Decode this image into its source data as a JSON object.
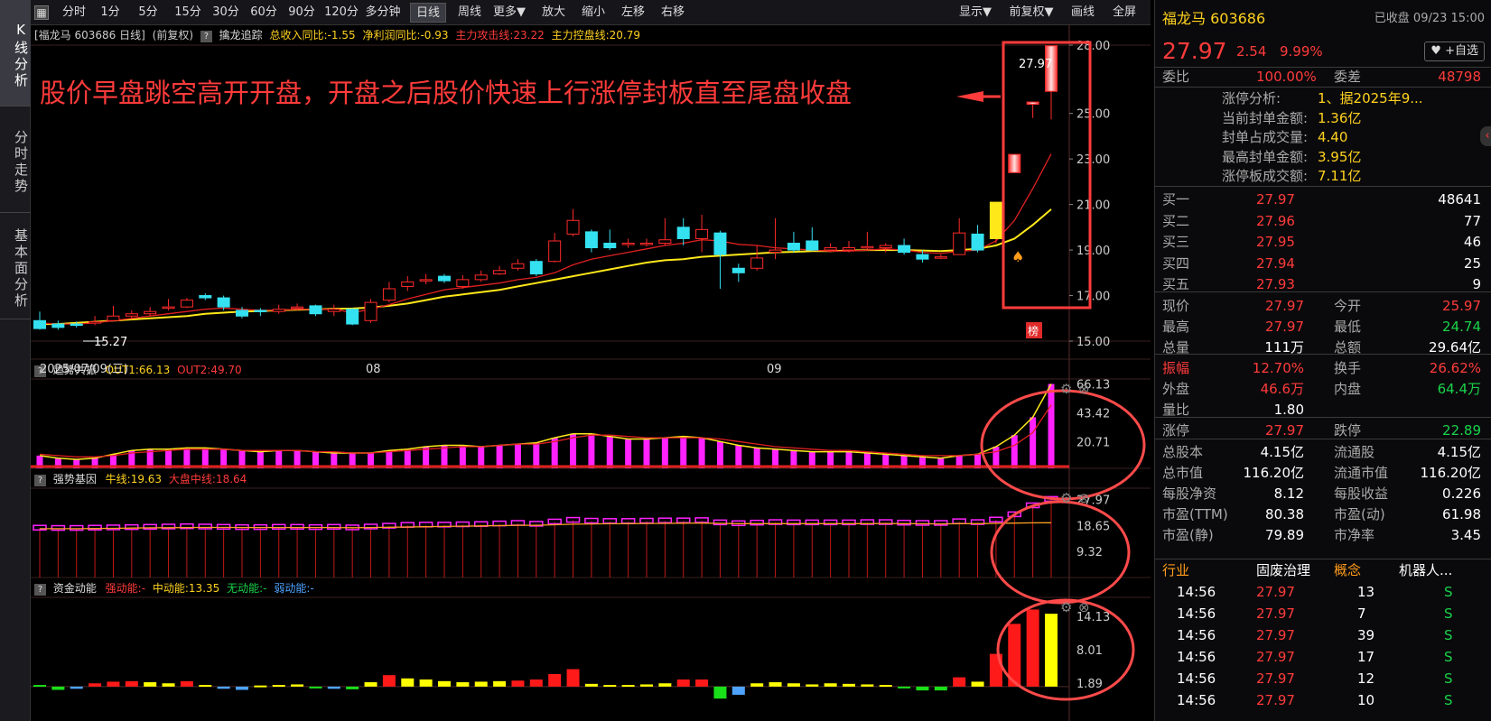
{
  "nav": {
    "tabs": [
      "K线分析",
      "分时走势",
      "基本面分析"
    ]
  },
  "toolbar": {
    "buttons": [
      "分时",
      "1分",
      "5分",
      "15分",
      "30分",
      "60分",
      "90分",
      "120分",
      "多分钟",
      "日线",
      "周线",
      "更多▼",
      "放大",
      "缩小",
      "左移",
      "右移"
    ],
    "right_buttons": [
      "显示▼",
      "前复权▼",
      "画线",
      "全屏"
    ],
    "active": "日线"
  },
  "info": {
    "stock": "[福龙马 603686 日线]",
    "adj": "(前复权)",
    "indicator": "擒龙追踪",
    "rev_yoy": "总收入同比:-1.55",
    "np_yoy": "净利润同比:-0.93",
    "attack": "主力攻击线:23.22",
    "control": "主力控盘线:20.79"
  },
  "annotation": {
    "text": "股价早盘跳空高开开盘，开盘之后股价快速上行涨停封板直至尾盘收盘",
    "price_label": "27.97",
    "low_label": "15.27",
    "bang": "榜"
  },
  "axis": {
    "date_label": "2025/07/09(三)",
    "month_labels": [
      "08",
      "09"
    ]
  },
  "chart_data": [
    {
      "type": "candlestick",
      "title": "福龙马 603686 日线",
      "ylim": [
        15.0,
        28.0
      ],
      "y_ticks": [
        "28.00",
        "25.00",
        "23.00",
        "21.00",
        "19.00",
        "17.00",
        "15.00"
      ],
      "candles": [
        [
          15.9,
          15.55,
          16.3,
          15.5
        ],
        [
          15.75,
          15.6,
          15.9,
          15.5
        ],
        [
          15.75,
          15.7,
          15.85,
          15.6
        ],
        [
          15.85,
          15.85,
          16.1,
          15.7
        ],
        [
          15.9,
          16.1,
          16.55,
          15.85
        ],
        [
          16.1,
          16.2,
          16.35,
          16.0
        ],
        [
          16.2,
          16.3,
          16.5,
          16.1
        ],
        [
          16.5,
          16.5,
          16.85,
          16.35
        ],
        [
          16.5,
          16.8,
          16.9,
          16.45
        ],
        [
          17.0,
          16.9,
          17.1,
          16.8
        ],
        [
          16.9,
          16.5,
          17.0,
          16.35
        ],
        [
          16.35,
          16.1,
          16.5,
          16.0
        ],
        [
          16.35,
          16.3,
          16.45,
          16.1
        ],
        [
          16.3,
          16.4,
          16.6,
          16.2
        ],
        [
          16.45,
          16.5,
          16.65,
          16.35
        ],
        [
          16.55,
          16.2,
          16.6,
          16.1
        ],
        [
          16.3,
          16.4,
          16.6,
          16.1
        ],
        [
          16.4,
          15.75,
          16.45,
          15.7
        ],
        [
          15.9,
          16.7,
          16.85,
          15.8
        ],
        [
          16.8,
          17.3,
          17.6,
          16.7
        ],
        [
          17.4,
          17.6,
          17.85,
          17.2
        ],
        [
          17.7,
          17.7,
          17.95,
          17.5
        ],
        [
          17.85,
          17.65,
          17.95,
          17.55
        ],
        [
          17.4,
          17.7,
          17.9,
          17.3
        ],
        [
          17.7,
          17.9,
          18.1,
          17.6
        ],
        [
          17.95,
          18.1,
          18.3,
          17.9
        ],
        [
          18.2,
          18.4,
          18.6,
          18.1
        ],
        [
          18.5,
          17.95,
          18.6,
          17.85
        ],
        [
          18.5,
          19.4,
          19.75,
          18.45
        ],
        [
          19.7,
          20.3,
          20.8,
          19.6
        ],
        [
          19.8,
          19.1,
          19.9,
          18.9
        ],
        [
          19.3,
          19.1,
          19.9,
          19.0
        ],
        [
          19.3,
          19.3,
          19.5,
          19.1
        ],
        [
          19.3,
          19.3,
          19.5,
          19.15
        ],
        [
          19.3,
          19.45,
          20.4,
          19.2
        ],
        [
          20.0,
          19.5,
          20.4,
          19.2
        ],
        [
          19.5,
          19.9,
          20.55,
          18.9
        ],
        [
          19.75,
          18.8,
          19.85,
          17.3
        ],
        [
          18.2,
          18.0,
          18.4,
          17.6
        ],
        [
          18.2,
          18.65,
          19.2,
          18.1
        ],
        [
          18.9,
          19.0,
          20.4,
          18.6
        ],
        [
          19.3,
          19.0,
          19.8,
          18.9
        ],
        [
          19.4,
          19.0,
          20.0,
          18.95
        ],
        [
          19.0,
          19.1,
          19.3,
          18.9
        ],
        [
          19.0,
          19.1,
          19.4,
          18.9
        ],
        [
          19.1,
          19.15,
          19.8,
          19.0
        ],
        [
          19.1,
          19.2,
          19.3,
          18.9
        ],
        [
          19.2,
          18.9,
          19.5,
          18.8
        ],
        [
          18.8,
          18.6,
          19.0,
          18.45
        ],
        [
          18.7,
          18.7,
          18.8,
          18.6
        ],
        [
          18.8,
          19.75,
          20.4,
          18.8
        ],
        [
          19.7,
          19.0,
          20.1,
          18.9
        ],
        [
          19.5,
          21.1,
          21.1,
          19.3
        ],
        [
          22.4,
          23.2,
          23.2,
          22.4
        ],
        [
          25.4,
          25.5,
          25.4,
          24.8
        ],
        [
          25.97,
          27.97,
          27.97,
          24.74
        ]
      ],
      "ma_attack": [
        15.8,
        15.75,
        15.75,
        15.8,
        15.9,
        16.0,
        16.1,
        16.2,
        16.3,
        16.4,
        16.45,
        16.4,
        16.35,
        16.35,
        16.4,
        16.4,
        16.4,
        16.25,
        16.4,
        16.6,
        16.85,
        17.05,
        17.25,
        17.35,
        17.45,
        17.55,
        17.7,
        17.8,
        18.0,
        18.35,
        18.6,
        18.75,
        18.9,
        19.05,
        19.2,
        19.3,
        19.45,
        19.4,
        19.25,
        19.2,
        19.1,
        19.05,
        19.0,
        18.95,
        18.95,
        19.0,
        19.05,
        19.0,
        18.9,
        18.85,
        18.95,
        19.0,
        19.4,
        20.3,
        21.7,
        23.22
      ],
      "ma_control": [
        15.75,
        15.75,
        15.8,
        15.85,
        15.9,
        15.95,
        16.0,
        16.05,
        16.1,
        16.2,
        16.25,
        16.3,
        16.32,
        16.35,
        16.38,
        16.4,
        16.42,
        16.43,
        16.48,
        16.55,
        16.65,
        16.8,
        16.95,
        17.05,
        17.15,
        17.25,
        17.4,
        17.55,
        17.7,
        17.85,
        18.0,
        18.15,
        18.3,
        18.45,
        18.55,
        18.6,
        18.7,
        18.75,
        18.8,
        18.85,
        18.9,
        18.92,
        18.95,
        18.95,
        18.98,
        19.0,
        19.0,
        19.0,
        18.98,
        18.95,
        19.0,
        19.05,
        19.2,
        19.5,
        20.1,
        20.79
      ]
    },
    {
      "type": "bar",
      "title": "趋势共振",
      "legend": [
        "OUT1:66.13",
        "OUT2:49.70"
      ],
      "y_ticks": [
        "66.13",
        "43.42",
        "20.71"
      ],
      "ylim": [
        0,
        70
      ],
      "out1": [
        10,
        8,
        7,
        8,
        11,
        14,
        15,
        15,
        16,
        16,
        15,
        14,
        13,
        14,
        14,
        13,
        12,
        12,
        12,
        14,
        15,
        17,
        18,
        18,
        17,
        18,
        19,
        20,
        24,
        27,
        27,
        25,
        23,
        23,
        24,
        25,
        24,
        21,
        18,
        16,
        15,
        14,
        13,
        13,
        13,
        12,
        11,
        10,
        9,
        8,
        10,
        11,
        17,
        26,
        40,
        66.13
      ],
      "out2": [
        11,
        10,
        9,
        9,
        10,
        12,
        13,
        14,
        15,
        15,
        15,
        14,
        14,
        14,
        14,
        13,
        13,
        12,
        12,
        13,
        14,
        15,
        16,
        17,
        17,
        18,
        19,
        19,
        21,
        24,
        26,
        26,
        25,
        24,
        24,
        24,
        24,
        23,
        21,
        19,
        17,
        16,
        15,
        14,
        14,
        13,
        12,
        11,
        10,
        10,
        10,
        11,
        13,
        18,
        28,
        49.7
      ]
    },
    {
      "type": "bar",
      "title": "强势基因",
      "legend": [
        "牛线:19.63",
        "大盘中线:18.64"
      ],
      "y_ticks": [
        "27.97",
        "18.65",
        "9.32"
      ],
      "ylim": [
        0,
        32
      ],
      "values": [
        17.7,
        17.6,
        17.6,
        17.7,
        17.8,
        17.9,
        18.0,
        18.1,
        18.2,
        18.1,
        18.0,
        17.9,
        17.9,
        18.0,
        18.0,
        17.9,
        18.0,
        17.8,
        18.1,
        18.4,
        18.7,
        18.8,
        18.8,
        18.9,
        19.0,
        19.2,
        19.4,
        19.1,
        19.9,
        20.5,
        20.2,
        20.1,
        20.1,
        20.2,
        20.3,
        20.3,
        20.4,
        19.6,
        19.3,
        19.5,
        19.7,
        19.6,
        19.6,
        19.6,
        19.6,
        19.7,
        19.7,
        19.5,
        19.4,
        19.4,
        20.0,
        19.7,
        20.6,
        22.5,
        25.7,
        28.0
      ],
      "bull_line": [
        17.5,
        17.5,
        17.5,
        17.55,
        17.6,
        17.7,
        17.8,
        17.85,
        17.9,
        17.95,
        17.95,
        17.9,
        17.9,
        17.9,
        17.9,
        17.9,
        17.9,
        17.85,
        17.9,
        18.0,
        18.1,
        18.2,
        18.3,
        18.4,
        18.5,
        18.6,
        18.7,
        18.7,
        18.9,
        19.1,
        19.2,
        19.25,
        19.3,
        19.35,
        19.4,
        19.45,
        19.5,
        19.4,
        19.3,
        19.3,
        19.3,
        19.3,
        19.3,
        19.3,
        19.3,
        19.3,
        19.35,
        19.3,
        19.25,
        19.2,
        19.3,
        19.3,
        19.4,
        19.5,
        19.6,
        19.63
      ]
    },
    {
      "type": "bar",
      "title": "资金动能",
      "legend": [
        "强动能:-",
        "中动能:13.35",
        "无动能:-",
        "弱动能:-"
      ],
      "y_ticks": [
        "14.13",
        "8.01",
        "1.89"
      ],
      "ylim": [
        -2,
        15
      ],
      "values": [
        0.3,
        -0.6,
        -0.4,
        0.6,
        0.9,
        1.0,
        0.8,
        0.6,
        1.0,
        0.3,
        -0.4,
        -0.6,
        0.2,
        0.3,
        0.4,
        -0.3,
        -0.4,
        -0.5,
        0.8,
        2.1,
        1.5,
        1.3,
        1.0,
        0.8,
        0.9,
        1.0,
        1.1,
        1.3,
        2.3,
        3.2,
        0.5,
        0.3,
        0.3,
        0.4,
        0.6,
        1.3,
        1.3,
        -2.2,
        -1.5,
        0.6,
        0.8,
        0.6,
        0.4,
        0.6,
        0.5,
        0.4,
        0.3,
        -0.3,
        -0.7,
        -0.7,
        1.7,
        0.9,
        6.0,
        11.5,
        14.13,
        13.35
      ],
      "colors": [
        "g",
        "g",
        "b",
        "r",
        "r",
        "r",
        "y",
        "y",
        "r",
        "y",
        "b",
        "b",
        "y",
        "y",
        "y",
        "g",
        "b",
        "g",
        "y",
        "r",
        "y",
        "y",
        "y",
        "y",
        "y",
        "y",
        "r",
        "r",
        "r",
        "r",
        "y",
        "y",
        "y",
        "y",
        "y",
        "r",
        "r",
        "g",
        "b",
        "y",
        "y",
        "y",
        "y",
        "y",
        "y",
        "y",
        "y",
        "g",
        "g",
        "g",
        "r",
        "y",
        "r",
        "r",
        "r",
        "y"
      ]
    }
  ],
  "right": {
    "name": "福龙马 603686",
    "status": "已收盘 09/23 15:00",
    "price": "27.97",
    "change": "2.54",
    "pct": "9.99%",
    "fav": "+自选",
    "weibi_label": "委比",
    "weibi": "100.00%",
    "weicha_label": "委差",
    "weicha": "48798",
    "limit_info": [
      {
        "label": "涨停分析:",
        "value": "1、据2025年9..."
      },
      {
        "label": "当前封单金额:",
        "value": "1.36亿"
      },
      {
        "label": "封单占成交量:",
        "value": "4.40"
      },
      {
        "label": "最高封单金额:",
        "value": "3.95亿"
      },
      {
        "label": "涨停板成交额:",
        "value": "7.11亿"
      }
    ],
    "bids": [
      {
        "label": "买一",
        "price": "27.97",
        "vol": "48641"
      },
      {
        "label": "买二",
        "price": "27.96",
        "vol": "77"
      },
      {
        "label": "买三",
        "price": "27.95",
        "vol": "46"
      },
      {
        "label": "买四",
        "price": "27.94",
        "vol": "25"
      },
      {
        "label": "买五",
        "price": "27.93",
        "vol": "9"
      }
    ],
    "quote": [
      [
        "现价",
        "27.97",
        "今开",
        "25.97"
      ],
      [
        "最高",
        "27.97",
        "最低",
        "24.74"
      ],
      [
        "总量",
        "111万",
        "总额",
        "29.64亿"
      ],
      [
        "振幅",
        "12.70%",
        "换手",
        "26.62%"
      ],
      [
        "外盘",
        "46.6万",
        "内盘",
        "64.4万"
      ],
      [
        "量比",
        "1.80",
        "",
        ""
      ],
      [
        "涨停",
        "27.97",
        "跌停",
        "22.89"
      ],
      [
        "总股本",
        "4.15亿",
        "流通股",
        "4.15亿"
      ],
      [
        "总市值",
        "116.20亿",
        "流通市值",
        "116.20亿"
      ],
      [
        "每股净资",
        "8.12",
        "每股收益",
        "0.226"
      ],
      [
        "市盈(TTM)",
        "80.38",
        "市盈(动)",
        "61.98"
      ],
      [
        "市盈(静)",
        "79.89",
        "市净率",
        "3.45"
      ]
    ],
    "industry": {
      "label": "行业",
      "value": "固废治理",
      "concept_label": "概念",
      "concept": "机器人..."
    },
    "ticks": [
      [
        "14:56",
        "27.97",
        "13",
        "S"
      ],
      [
        "14:56",
        "27.97",
        "7",
        "S"
      ],
      [
        "14:56",
        "27.97",
        "39",
        "S"
      ],
      [
        "14:56",
        "27.97",
        "17",
        "S"
      ],
      [
        "14:56",
        "27.97",
        "12",
        "S"
      ],
      [
        "14:56",
        "27.97",
        "10",
        "S"
      ]
    ]
  }
}
